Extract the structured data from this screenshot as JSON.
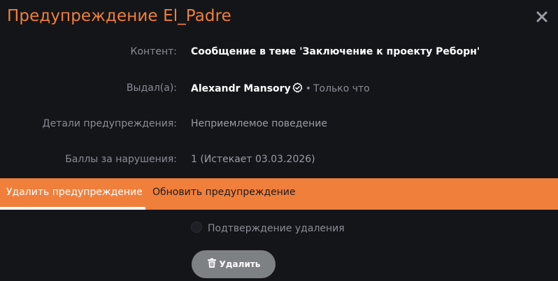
{
  "dialog": {
    "title": "Предупреждение El_Padre",
    "close_icon": "close-icon"
  },
  "details": {
    "content": {
      "label": "Контент:",
      "value": "Сообщение в теме 'Заключение к проекту Реборн'"
    },
    "issued_by": {
      "label": "Выдал(а):",
      "user": "Alexandr Mansory",
      "verified_icon": "verified-icon",
      "separator": "•",
      "time": "Только что"
    },
    "warning_details": {
      "label": "Детали предупреждения:",
      "value": "Неприемлемое поведение"
    },
    "points": {
      "label": "Баллы за нарушения:",
      "value": "1 (Истекает 03.03.2026)"
    }
  },
  "tabs": [
    {
      "label": "Удалить предупреждение",
      "active": true
    },
    {
      "label": "Обновить предупреждение",
      "active": false
    }
  ],
  "delete_form": {
    "confirm_label": "Подтверждение удаления",
    "confirm_checked": false,
    "button_label": "Удалить",
    "button_icon": "trash-icon"
  },
  "colors": {
    "accent": "#f07f3c",
    "background": "#141519",
    "button": "#7e8184"
  }
}
